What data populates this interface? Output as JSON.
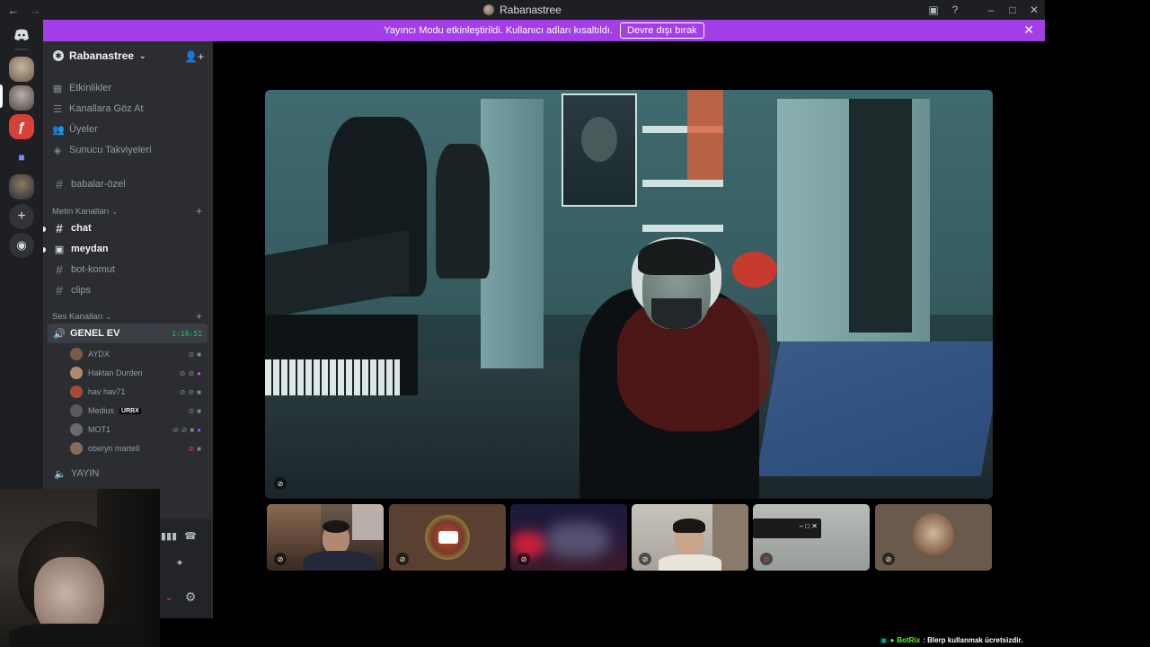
{
  "window": {
    "title": "Rabanastree"
  },
  "banner": {
    "text": "Yayıncı Modu etkinleştirildi. Kullanıcı adları kısaltıldı.",
    "button": "Devre dışı bırak"
  },
  "server": {
    "name": "Rabanastree",
    "nav": [
      {
        "label": "Etkinlikler",
        "icon": "calendar-icon"
      },
      {
        "label": "Kanallara Göz At",
        "icon": "browse-channels-icon"
      },
      {
        "label": "Üyeler",
        "icon": "members-icon"
      },
      {
        "label": "Sunucu Takviyeleri",
        "icon": "boost-icon"
      }
    ],
    "pinned_channel": "babalar-özel",
    "text_category": "Metin Kanalları",
    "text_channels": [
      {
        "name": "chat",
        "unread": true
      },
      {
        "name": "meydan",
        "unread": true
      },
      {
        "name": "bot-komut",
        "unread": false
      },
      {
        "name": "clips",
        "unread": false
      }
    ],
    "voice_category": "Ses Kanalları",
    "voice_channel": {
      "name": "GENEL EV",
      "timer": "1:16:51"
    },
    "voice_users": [
      {
        "name": "AYDX",
        "tag": "",
        "color": "#7a5a48"
      },
      {
        "name": "Haktan Durden",
        "tag": "",
        "color": "#b08a6a"
      },
      {
        "name": "hav hav71",
        "tag": "",
        "color": "#a64a3a"
      },
      {
        "name": "Medius",
        "tag": "URBX",
        "color": "#5a5a5a"
      },
      {
        "name": "MOT1",
        "tag": "",
        "color": "#6a6a6a"
      },
      {
        "name": "oberyn martell",
        "tag": "",
        "color": "#8a6a5a"
      }
    ],
    "second_voice_channel": "YAYIN"
  },
  "botrix": {
    "name": "BotRix",
    "message": ": Blerp kullanmak ücretsizdir."
  },
  "colors": {
    "accent_banner": "#a33ee8",
    "live_green": "#23a55a"
  }
}
